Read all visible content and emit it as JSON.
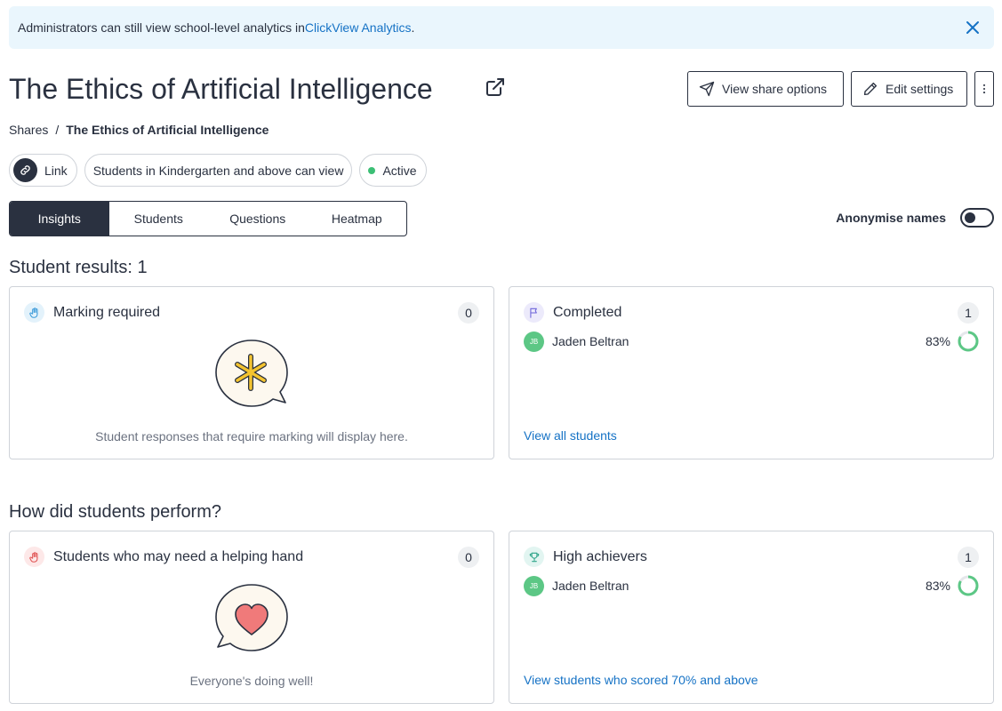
{
  "banner": {
    "text": "Administrators can still view school-level analytics in ",
    "link": "ClickView Analytics",
    "suffix": ".",
    "close_icon": "close-icon"
  },
  "header": {
    "title": "The Ethics of Artificial Intelligence",
    "share_label": "View share options",
    "edit_label": "Edit settings"
  },
  "breadcrumb": {
    "root": "Shares",
    "separator": "/",
    "current": "The Ethics of Artificial Intelligence"
  },
  "chips": {
    "link": "Link",
    "audience": "Students in Kindergarten and above can view",
    "status": "Active"
  },
  "tabs": [
    {
      "label": "Insights",
      "active": true
    },
    {
      "label": "Students",
      "active": false
    },
    {
      "label": "Questions",
      "active": false
    },
    {
      "label": "Heatmap",
      "active": false
    }
  ],
  "anonymise": {
    "label": "Anonymise names",
    "on": false
  },
  "results": {
    "title": "Student results: 1",
    "marking": {
      "title": "Marking required",
      "count": "0",
      "empty": "Student responses that require marking will display here."
    },
    "completed": {
      "title": "Completed",
      "count": "1",
      "student": {
        "initials": "JB",
        "name": "Jaden Beltran",
        "score": "83%",
        "fraction": 0.83
      },
      "link": "View all students"
    }
  },
  "performance": {
    "title": "How did students perform?",
    "helping": {
      "title": "Students who may need a helping hand",
      "count": "0",
      "empty": "Everyone's doing well!"
    },
    "high": {
      "title": "High achievers",
      "count": "1",
      "student": {
        "initials": "JB",
        "name": "Jaden Beltran",
        "score": "83%",
        "fraction": 0.83
      },
      "link": "View students who scored 70% and above"
    }
  },
  "colors": {
    "accent": "#1572c5",
    "dark": "#2a3140",
    "success": "#3cbf75",
    "banner_bg": "#eaf6fd"
  }
}
